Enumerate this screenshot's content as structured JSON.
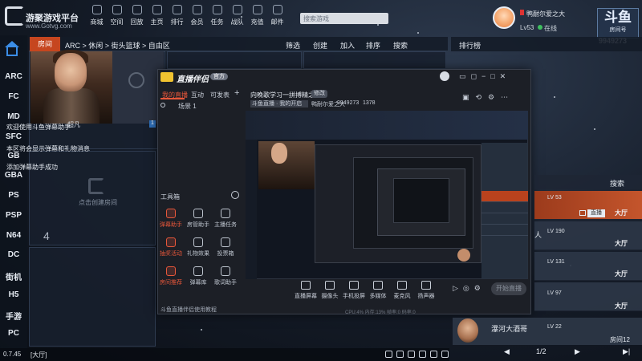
{
  "app": {
    "title": "游聚游戏平台",
    "url": "www.Gotvg.com"
  },
  "topnav": [
    {
      "label": "商城",
      "icon": "shop-icon"
    },
    {
      "label": "空间",
      "icon": "space-icon"
    },
    {
      "label": "回放",
      "icon": "replay-icon"
    },
    {
      "label": "主页",
      "icon": "home-page-icon"
    },
    {
      "label": "排行",
      "icon": "ranking-icon"
    },
    {
      "label": "会员",
      "icon": "member-icon"
    },
    {
      "label": "任务",
      "icon": "task-icon"
    },
    {
      "label": "战队",
      "icon": "team-icon"
    },
    {
      "label": "充值",
      "icon": "recharge-icon"
    },
    {
      "label": "邮件",
      "icon": "mail-icon"
    }
  ],
  "search": {
    "placeholder": "搜索游戏"
  },
  "user": {
    "name": "鸭耐尔爱之大",
    "level": "Lv53",
    "status": "在线"
  },
  "overlay": {
    "logo": "斗鱼",
    "sub": "房间号",
    "room_count": "9949273"
  },
  "sidebar": [
    "ARC",
    "FC",
    "MD",
    "SFC",
    "GB",
    "GBA",
    "PS",
    "PSP",
    "N64",
    "DC",
    "街机",
    "H5",
    "手游",
    "PC"
  ],
  "crumbbar": {
    "tab": "房间",
    "breadcrumb": "ARC > 休闲 > 街头篮球 > 自由区",
    "buttons": [
      "筛选",
      "创建",
      "加入",
      "排序",
      "搜索"
    ]
  },
  "room": {
    "number": "1",
    "empty_label": "点击创建房间",
    "number4": "4",
    "host_name": "超凡"
  },
  "chat": [
    "欢迎使用斗鱼弹幕助手",
    "本区将会显示弹幕和礼物消息",
    "添加弹幕助手成功"
  ],
  "main_window": {
    "title": "直播伴侣",
    "badge": "官方",
    "tabs": [
      "我的直播",
      "互动",
      "可发表"
    ],
    "scene": "场景 1",
    "tools_title": "工具箱",
    "tools": [
      {
        "label": "弹幕助手",
        "hot": true
      },
      {
        "label": "房管助手",
        "hot": false
      },
      {
        "label": "主播任务",
        "hot": false
      },
      {
        "label": "抽奖活动",
        "hot": true
      },
      {
        "label": "礼物效果",
        "hot": false
      },
      {
        "label": "投票箱",
        "hot": false
      },
      {
        "label": "房间推荐",
        "hot": true
      },
      {
        "label": "弹幕库",
        "hot": false
      },
      {
        "label": "歌词助手",
        "hot": false
      }
    ],
    "footer": "斗鱼直播伴侣使用教程",
    "stream_title": "向晚歌学习一拼搏精之子!",
    "stream_tag": "修改",
    "sub": [
      "斗鱼直播 · 我的开启",
      "鸭耐尔爱之大",
      "9949273",
      "1378"
    ],
    "bottom_tools": [
      "直播屏幕",
      "摄像头",
      "手机投屏",
      "多媒体",
      "麦克风",
      "扬声器"
    ],
    "start": "开始直播",
    "stats": "CPU:4%  内存:13%  帧率:0  码率:0"
  },
  "right_panel": {
    "rank_label": "排行榜",
    "search": "搜索",
    "rows": [
      {
        "lv": "LV 53",
        "hall": "大厅",
        "live": "直播",
        "hl": true
      },
      {
        "lv": "LV 190",
        "hall": "大厅",
        "hl": false
      },
      {
        "lv": "LV 131",
        "hall": "大厅",
        "hl": false
      },
      {
        "lv": "LV 97",
        "hall": "大厅",
        "hl": false
      }
    ],
    "bottom_card": {
      "name": "瀑河大酒哥",
      "lv": "LV 22",
      "room": "房间12"
    },
    "pager": "1/2",
    "chat_fragment": "人"
  },
  "statusbar": {
    "version": "0.7.45",
    "lobby": "[大厅]"
  }
}
